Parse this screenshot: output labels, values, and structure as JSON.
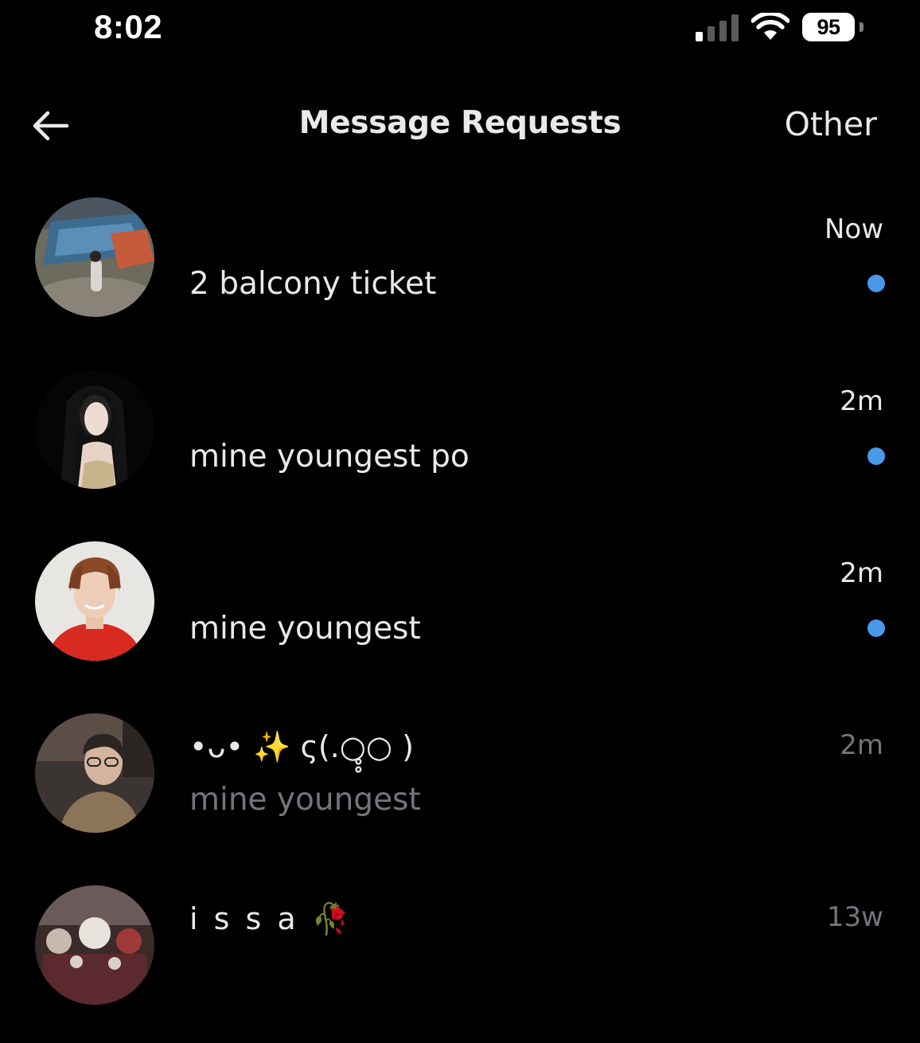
{
  "status_bar": {
    "time": "8:02",
    "battery": "95",
    "signal_icon": "cellular-signal-icon",
    "wifi_icon": "wifi-icon"
  },
  "header": {
    "title": "Message Requests",
    "back_icon": "back-arrow-icon",
    "other_label": "Other"
  },
  "colors": {
    "background": "#000000",
    "text_primary": "#e7e9ea",
    "text_secondary": "#71767b",
    "unread_dot": "#4a99e9"
  },
  "conversations": [
    {
      "name": "",
      "preview": "2 balcony ticket",
      "time": "Now",
      "unread": true
    },
    {
      "name": "",
      "preview": "mine youngest po",
      "time": "2m",
      "unread": true
    },
    {
      "name": "",
      "preview": "mine youngest",
      "time": "2m",
      "unread": true
    },
    {
      "name": "•ᴗ• ✨ ς(.○̥̥○ )",
      "preview": "mine youngest",
      "time": "2m",
      "unread": false
    },
    {
      "name": "i s s a 🥀",
      "preview": "",
      "time": "13w",
      "unread": false
    }
  ]
}
